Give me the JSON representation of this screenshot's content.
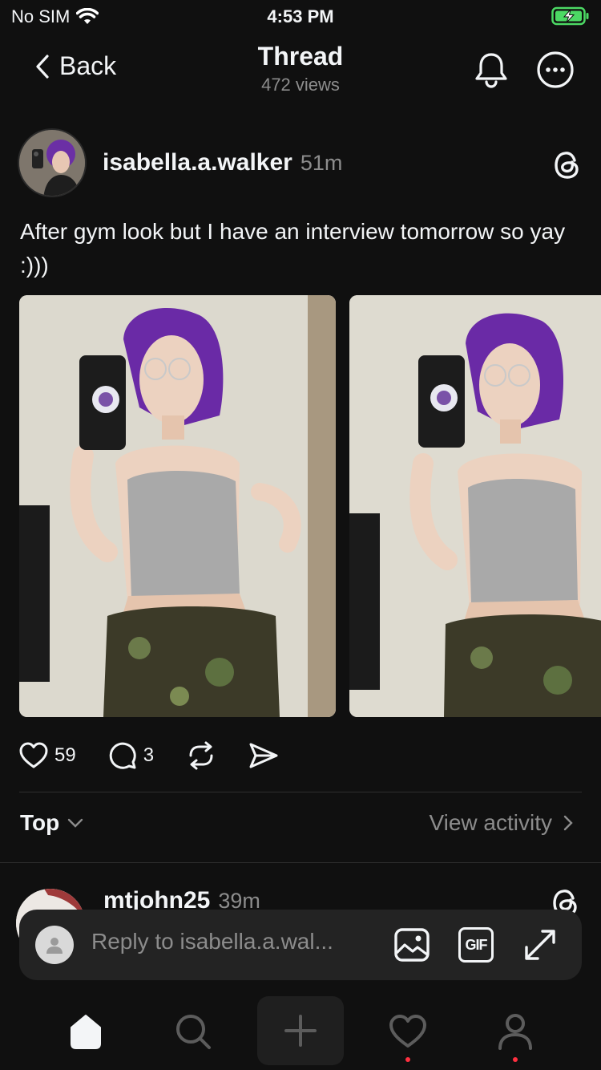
{
  "status_bar": {
    "carrier": "No SIM",
    "time": "4:53 PM"
  },
  "header": {
    "back_label": "Back",
    "title": "Thread",
    "views": "472 views"
  },
  "post": {
    "username": "isabella.a.walker",
    "time": "51m",
    "text": "After gym look but I have an interview tomorrow so yay :)))",
    "likes": "59",
    "comments": "3"
  },
  "sort": {
    "label": "Top",
    "view_activity": "View activity"
  },
  "comment": {
    "username": "mtjohn25",
    "time": "39m"
  },
  "reply": {
    "placeholder": "Reply to isabella.a.wal..."
  },
  "reply_icons": {
    "gif_label": "GIF"
  },
  "colors": {
    "background": "#101010",
    "text": "#f3f5f7",
    "muted": "#8c8c8c",
    "notification_dot": "#ff3040",
    "battery": "#4cd964"
  }
}
